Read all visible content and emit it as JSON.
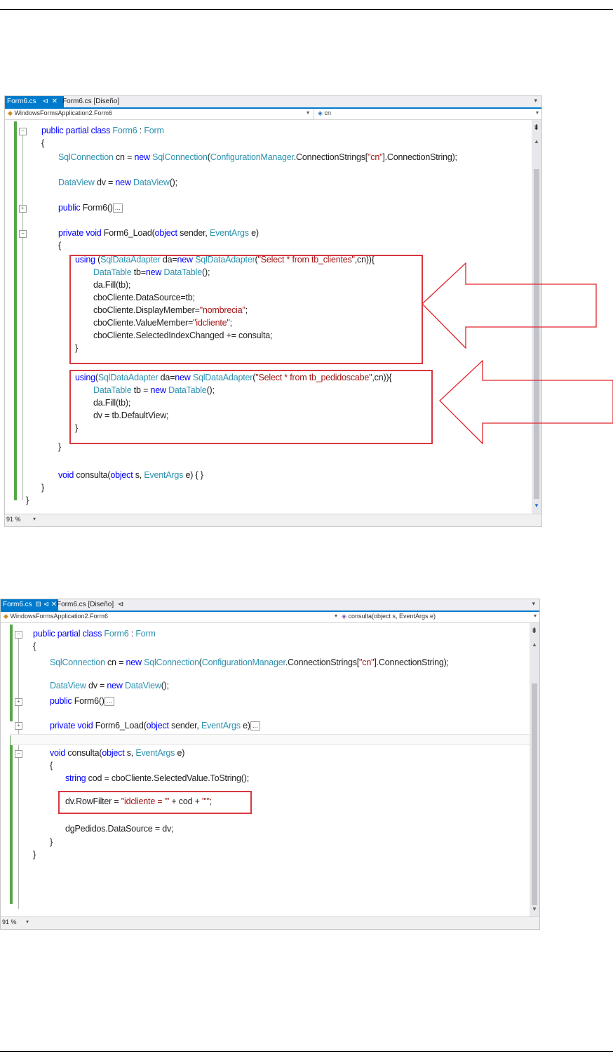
{
  "screenshot1": {
    "tabs": [
      {
        "label": "Form6.cs",
        "active": true
      },
      {
        "label": "Form6.cs [Diseño]",
        "active": false
      }
    ],
    "tab_pin": "⊲",
    "tab_close": "✕",
    "nav_left": "WindowsFormsApplication2.Form6",
    "nav_right": "cn",
    "zoom": "91 %",
    "code": {
      "l1_kw": "public partial class ",
      "l1_ty": "Form6",
      "l1_sep": " : ",
      "l1_base": "Form",
      "l2": "{",
      "l3_ty1": "SqlConnection",
      "l3_a": " cn = ",
      "l3_kw": "new ",
      "l3_ty2": "SqlConnection",
      "l3_b": "(",
      "l3_ty3": "ConfigurationManager",
      "l3_c": ".ConnectionStrings[",
      "l3_st": "\"cn\"",
      "l3_d": "].ConnectionString);",
      "l4_ty1": "DataView",
      "l4_a": " dv = ",
      "l4_kw": "new ",
      "l4_ty2": "DataView",
      "l4_b": "();",
      "l5_kw": "public ",
      "l5_a": "Form6()",
      "ellipsis": "...",
      "l6_kw1": "private void ",
      "l6_a": "Form6_Load(",
      "l6_kw2": "object",
      "l6_b": " sender, ",
      "l6_ty": "EventArgs",
      "l6_c": " e)",
      "l7": "{",
      "u1_kw": "using ",
      "u1_a": "(",
      "u1_ty1": "SqlDataAdapter",
      "u1_b": " da=",
      "u1_kw2": "new ",
      "u1_ty2": "SqlDataAdapter",
      "u1_c": "(",
      "u1_st": "\"Select * from tb_clientes\"",
      "u1_d": ",cn)){",
      "u2_ty1": "DataTable",
      "u2_a": " tb=",
      "u2_kw": "new ",
      "u2_ty2": "DataTable",
      "u2_b": "();",
      "u3": "da.Fill(tb);",
      "u4": "cboCliente.DataSource=tb;",
      "u5_a": "cboCliente.DisplayMember=",
      "u5_st": "\"nombrecia\"",
      "u5_b": ";",
      "u6_a": "cboCliente.ValueMember=",
      "u6_st": "\"idcliente\"",
      "u6_b": ";",
      "u7": "cboCliente.SelectedIndexChanged += consulta;",
      "u8": "}",
      "v1_kw": "using",
      "v1_a": "(",
      "v1_ty1": "SqlDataAdapter",
      "v1_b": " da=",
      "v1_kw2": "new ",
      "v1_ty2": "SqlDataAdapter",
      "v1_c": "(",
      "v1_st": "\"Select * from tb_pedidoscabe\"",
      "v1_d": ",cn)){",
      "v2_ty1": "DataTable",
      "v2_a": " tb = ",
      "v2_kw": "new ",
      "v2_ty2": "DataTable",
      "v2_b": "();",
      "v3": "da.Fill(tb);",
      "v4": "dv = tb.DefaultView;",
      "v5": "}",
      "l8": "}",
      "l9_kw": "void ",
      "l9_a": "consulta(",
      "l9_kw2": "object",
      "l9_b": " s, ",
      "l9_ty": "EventArgs",
      "l9_c": " e) { }",
      "l10": "}",
      "l11": "}"
    }
  },
  "screenshot2": {
    "tabs": [
      {
        "label": "Form6.cs",
        "active": true
      },
      {
        "label": "Form6.cs [Diseño]",
        "active": false
      }
    ],
    "tab_icons": "⊟ ⊲ ✕",
    "tab2_pin": "⊲",
    "nav_left": "WindowsFormsApplication2.Form6",
    "nav_right": "consulta(object s, EventArgs e)",
    "zoom": "91 %",
    "code": {
      "l1_kw": "public partial class ",
      "l1_ty": "Form6",
      "l1_sep": " : ",
      "l1_base": "Form",
      "l2": "{",
      "l3_ty1": "SqlConnection",
      "l3_a": " cn = ",
      "l3_kw": "new ",
      "l3_ty2": "SqlConnection",
      "l3_b": "(",
      "l3_ty3": "ConfigurationManager",
      "l3_c": ".ConnectionStrings[",
      "l3_st": "\"cn\"",
      "l3_d": "].ConnectionString);",
      "l4_ty1": "DataView",
      "l4_a": " dv = ",
      "l4_kw": "new ",
      "l4_ty2": "DataView",
      "l4_b": "();",
      "l5_kw": "public ",
      "l5_a": "Form6()",
      "ellipsis": "...",
      "l6_kw1": "private void ",
      "l6_a": "Form6_Load(",
      "l6_kw2": "object",
      "l6_b": " sender, ",
      "l6_ty": "EventArgs",
      "l6_c": " e)",
      "l7_kw": "void ",
      "l7_a": "consulta(",
      "l7_kw2": "object",
      "l7_b": " s, ",
      "l7_ty": "EventArgs",
      "l7_c": " e)",
      "l8": "{",
      "l9_kw": "string",
      "l9_a": " cod = cboCliente.SelectedValue.ToString();",
      "l10_a": "dv.RowFilter = ",
      "l10_st1": "\"idcliente = '\"",
      "l10_b": " + cod + ",
      "l10_st2": "\"'\"",
      "l10_c": ";",
      "l11": "dgPedidos.DataSource = dv;",
      "l12": "}",
      "l13": "}"
    }
  },
  "colors": {
    "keyword": "#0000ff",
    "type": "#2b91af",
    "string": "#a31515",
    "tab_active": "#007acc",
    "highlight_box": "#d9363e",
    "arrow": "#e0252b",
    "change_margin": "#57a64a"
  }
}
